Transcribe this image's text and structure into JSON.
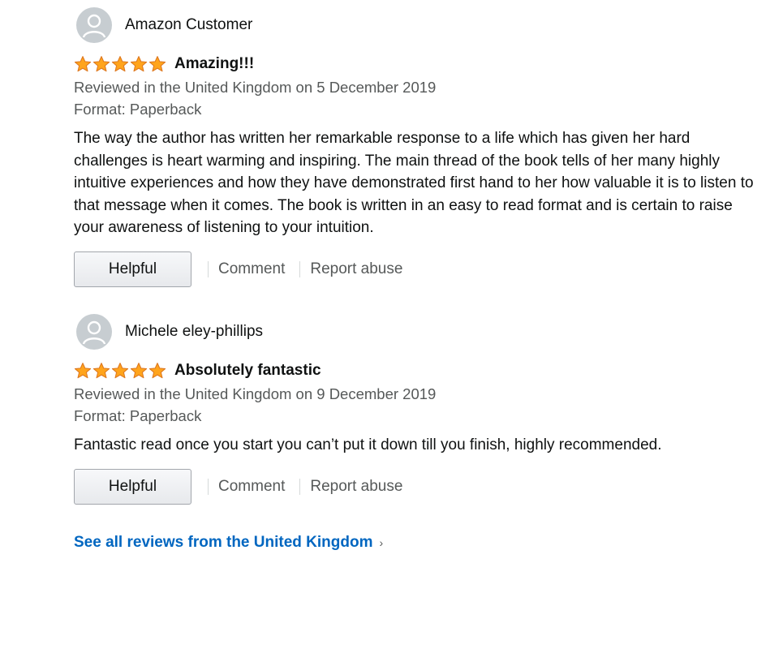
{
  "reviews": [
    {
      "reviewer": "Amazon Customer",
      "rating": 5,
      "title": "Amazing!!!",
      "date_line": "Reviewed in the United Kingdom on 5 December 2019",
      "format": "Format: Paperback",
      "body": "The way the author has written her remarkable response to a life which has given her hard challenges is heart warming and inspiring. The main thread of the book tells of her many highly intuitive experiences and how they have demonstrated first hand to her how valuable it is to listen to that message when it comes. The book is written in an easy to read format and is certain to raise your awareness of listening to your intuition.",
      "helpful_label": "Helpful",
      "comment_label": "Comment",
      "report_label": "Report abuse"
    },
    {
      "reviewer": "Michele eley-phillips",
      "rating": 5,
      "title": "Absolutely fantastic",
      "date_line": "Reviewed in the United Kingdom on 9 December 2019",
      "format": "Format: Paperback",
      "body": "Fantastic read once you start you can’t put it down till you finish, highly recommended.",
      "helpful_label": "Helpful",
      "comment_label": "Comment",
      "report_label": "Report abuse"
    }
  ],
  "see_all_link": "See all reviews from the United Kingdom",
  "icons": {
    "avatar": "default-user-avatar-icon",
    "star": "star-icon",
    "chevron": "chevron-right-icon"
  },
  "colors": {
    "star_fill": "#ffa41c",
    "star_stroke": "#de7921",
    "link": "#0066c0",
    "meta_text": "#565959",
    "avatar_bg": "#c7cdd1"
  }
}
